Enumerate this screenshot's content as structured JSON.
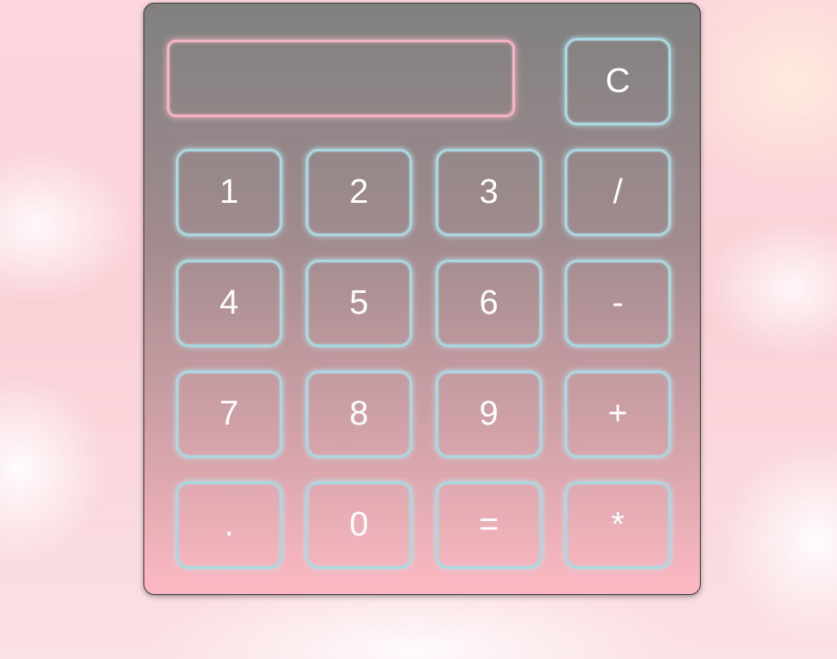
{
  "display": {
    "value": "",
    "placeholder": ""
  },
  "keys": {
    "clear": "C",
    "one": "1",
    "two": "2",
    "three": "3",
    "divide": "/",
    "four": "4",
    "five": "5",
    "six": "6",
    "subtract": "-",
    "seven": "7",
    "eight": "8",
    "nine": "9",
    "add": "+",
    "decimal": ".",
    "zero": "0",
    "equals": "=",
    "multiply": "*"
  },
  "colors": {
    "display_border": "#f6b4c2",
    "key_border": "#a9d8e0",
    "panel_top": "#808080",
    "panel_bottom": "#fdb9c3",
    "key_text": "#ffffff"
  }
}
